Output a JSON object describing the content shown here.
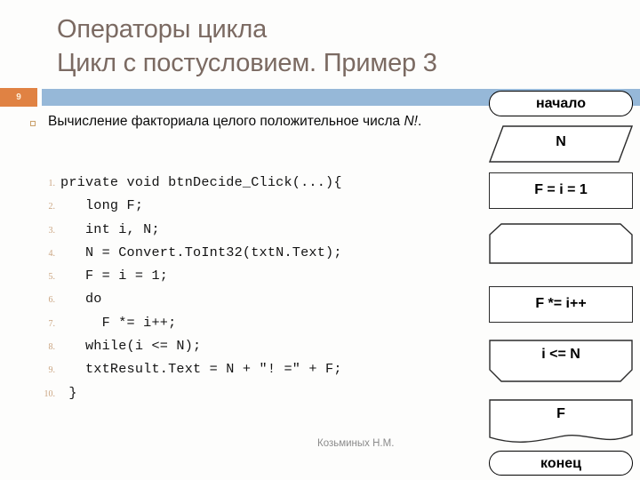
{
  "slide": {
    "title": "Операторы цикла\nЦикл с постусловием. Пример 3",
    "page_number": "9",
    "footer_author": "Козьминых Н.М.",
    "accent_orange": "#e08243",
    "accent_blue": "#96b8d8",
    "title_color": "#7b6a62"
  },
  "bullet": {
    "text_before": "Вычисление факториала целого положительное числа ",
    "text_italic": "N!",
    "text_after": "."
  },
  "code": {
    "lines": [
      {
        "n": "1.",
        "text": "private void btnDecide_Click(...){"
      },
      {
        "n": "2.",
        "text": "   long F;"
      },
      {
        "n": "3.",
        "text": "   int i, N;"
      },
      {
        "n": "4.",
        "text": "   N = Convert.ToInt32(txtN.Text);"
      },
      {
        "n": "5.",
        "text": "   F = i = 1;"
      },
      {
        "n": "6.",
        "text": "   do"
      },
      {
        "n": "7.",
        "text": "     F *= i++;"
      },
      {
        "n": "8.",
        "text": "   while(i <= N);"
      },
      {
        "n": "9.",
        "text": "   txtResult.Text = N + \"! =\" + F;"
      },
      {
        "n": "10.",
        "text": " }"
      }
    ]
  },
  "flowchart": {
    "nodes": [
      {
        "id": "start",
        "shape": "terminator",
        "label": "начало"
      },
      {
        "id": "input-n",
        "shape": "parallelogram",
        "label": "N"
      },
      {
        "id": "init",
        "shape": "rectangle",
        "label": "F = i = 1"
      },
      {
        "id": "loop-start",
        "shape": "loop-begin",
        "label": ""
      },
      {
        "id": "body",
        "shape": "rectangle",
        "label": "F *= i++"
      },
      {
        "id": "loop-end",
        "shape": "loop-end",
        "label": "i <= N"
      },
      {
        "id": "output-f",
        "shape": "document",
        "label": "F"
      },
      {
        "id": "end",
        "shape": "terminator",
        "label": "конец"
      }
    ]
  }
}
